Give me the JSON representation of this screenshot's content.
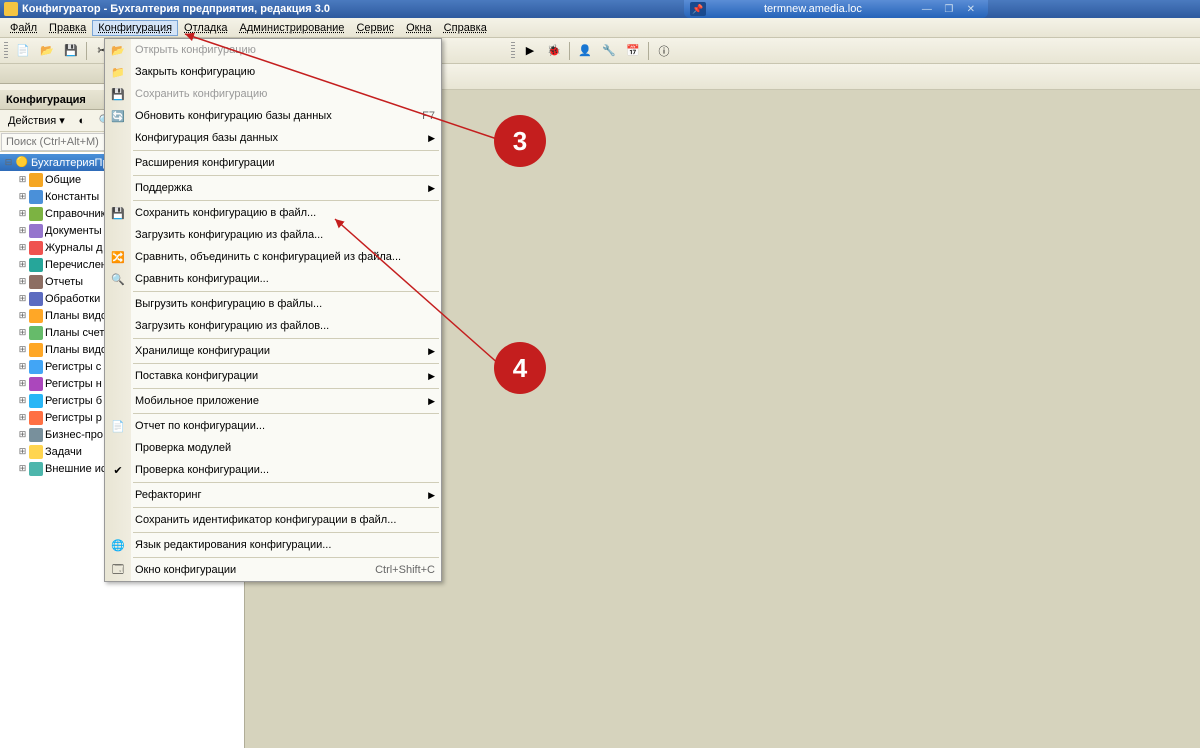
{
  "remote": {
    "host": "termnew.amedia.loc"
  },
  "title": "Конфигуратор - Бухгалтерия предприятия, редакция 3.0",
  "menubar": [
    "Файл",
    "Правка",
    "Конфигурация",
    "Отладка",
    "Администрирование",
    "Сервис",
    "Окна",
    "Справка"
  ],
  "menubar_active_index": 2,
  "sidebar": {
    "title": "Конфигурация",
    "actions_label": "Действия",
    "search_placeholder": "Поиск (Ctrl+Alt+M)",
    "root": "БухгалтерияПр",
    "items": [
      "Общие",
      "Константы",
      "Справочник",
      "Документы",
      "Журналы д",
      "Перечислен",
      "Отчеты",
      "Обработки",
      "Планы видо",
      "Планы счет",
      "Планы видо",
      "Регистры с",
      "Регистры н",
      "Регистры б",
      "Регистры р",
      "Бизнес-про",
      "Задачи",
      "Внешние ис"
    ]
  },
  "dropdown": [
    {
      "label": "Открыть конфигурацию",
      "icon": "📂",
      "disabled": true
    },
    {
      "label": "Закрыть конфигурацию",
      "icon": "📁"
    },
    {
      "label": "Сохранить конфигурацию",
      "icon": "💾",
      "disabled": true
    },
    {
      "label": "Обновить конфигурацию базы данных",
      "icon": "🔄",
      "shortcut": "F7"
    },
    {
      "label": "Конфигурация базы данных",
      "submenu": true
    },
    {
      "sep": true
    },
    {
      "label": "Расширения конфигурации"
    },
    {
      "sep": true
    },
    {
      "label": "Поддержка",
      "submenu": true
    },
    {
      "sep": true
    },
    {
      "label": "Сохранить конфигурацию в файл...",
      "icon": "💾"
    },
    {
      "label": "Загрузить конфигурацию из файла..."
    },
    {
      "label": "Сравнить, объединить с конфигурацией из файла...",
      "icon": "🔀"
    },
    {
      "label": "Сравнить конфигурации...",
      "icon": "🔍"
    },
    {
      "sep": true
    },
    {
      "label": "Выгрузить конфигурацию в файлы..."
    },
    {
      "label": "Загрузить конфигурацию из файлов..."
    },
    {
      "sep": true
    },
    {
      "label": "Хранилище конфигурации",
      "submenu": true
    },
    {
      "sep": true
    },
    {
      "label": "Поставка конфигурации",
      "submenu": true
    },
    {
      "sep": true
    },
    {
      "label": "Мобильное приложение",
      "submenu": true
    },
    {
      "sep": true
    },
    {
      "label": "Отчет по конфигурации...",
      "icon": "📄"
    },
    {
      "label": "Проверка модулей"
    },
    {
      "label": "Проверка конфигурации...",
      "icon": "✔"
    },
    {
      "sep": true
    },
    {
      "label": "Рефакторинг",
      "submenu": true
    },
    {
      "sep": true
    },
    {
      "label": "Сохранить идентификатор конфигурации в файл..."
    },
    {
      "sep": true
    },
    {
      "label": "Язык редактирования конфигурации...",
      "icon": "🌐"
    },
    {
      "sep": true
    },
    {
      "label": "Окно конфигурации",
      "icon": "🗔",
      "shortcut": "Ctrl+Shift+C"
    }
  ],
  "annotations": {
    "badge3": "3",
    "badge4": "4"
  }
}
